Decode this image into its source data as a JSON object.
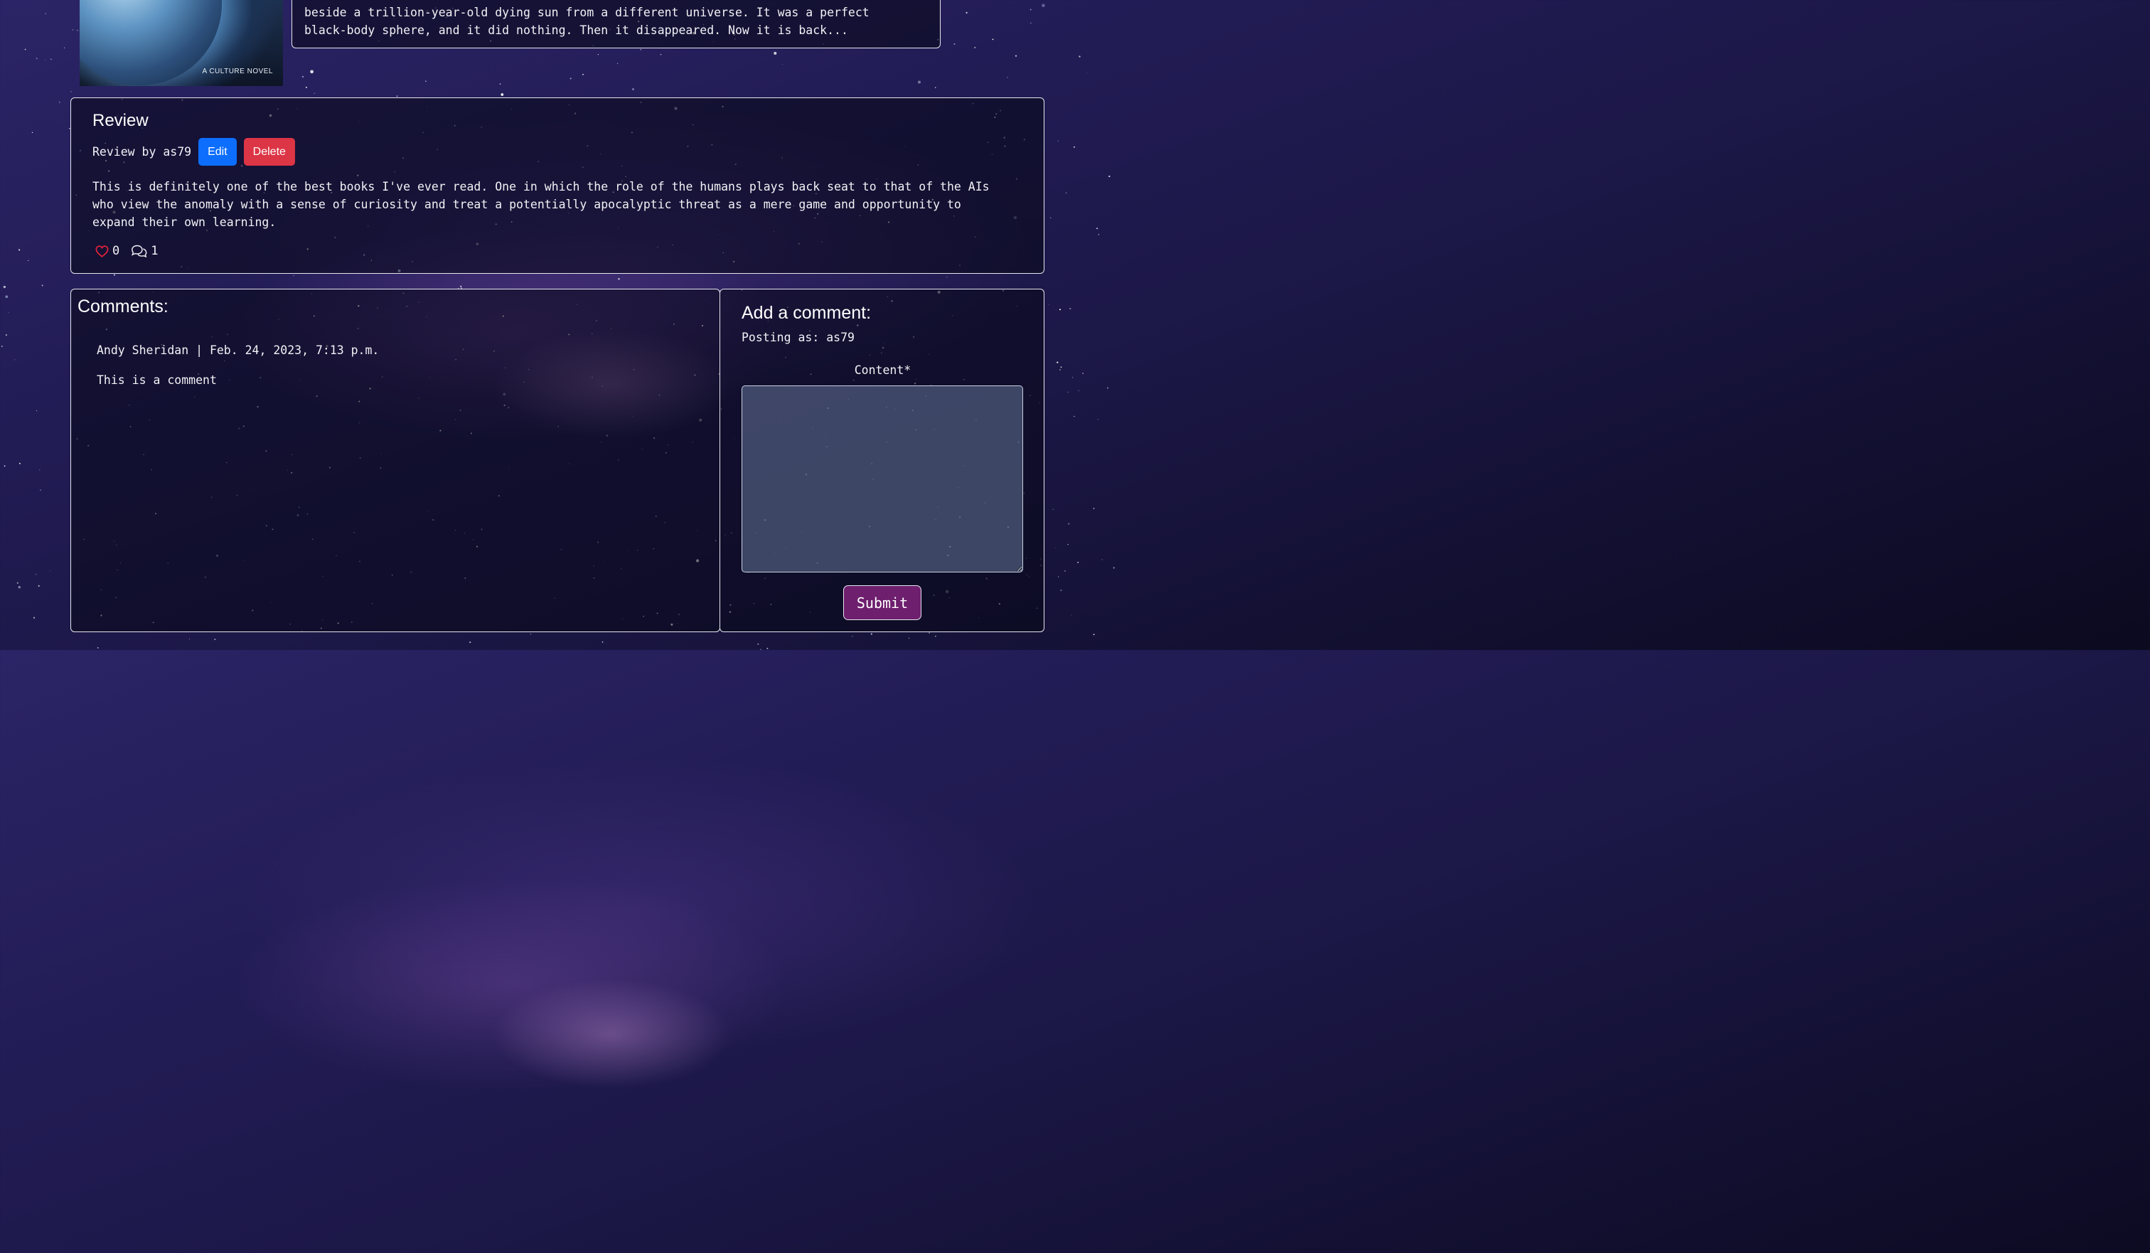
{
  "book": {
    "cover_caption": "A CULTURE NOVEL",
    "synopsis_lines": [
      "beside a trillion-year-old dying sun from a different universe. It was a perfect",
      "black-body sphere, and it did nothing. Then it disappeared. Now it is back..."
    ]
  },
  "review": {
    "title": "Review",
    "by_label": "Review by as79",
    "edit_label": "Edit",
    "delete_label": "Delete",
    "body_lines": [
      "This is definitely one of the best books I've ever read. One in which the role of the humans plays back seat to that of the AIs",
      "who view the anomaly with a sense of curiosity and treat a potentially apocalyptic threat as a mere game and opportunity to",
      "expand their own learning."
    ],
    "likes": "0",
    "comment_count": "1",
    "heart_icon": "heart-outline-icon",
    "comment_icon": "chat-bubbles-icon"
  },
  "comments": {
    "title": "Comments:",
    "items": [
      {
        "meta": "Andy Sheridan | Feb. 24, 2023, 7:13 p.m.",
        "body": "This is a comment"
      }
    ]
  },
  "add_comment": {
    "title": "Add a comment:",
    "posting_as": "Posting as: as79",
    "content_label": "Content*",
    "content_value": "",
    "submit_label": "Submit"
  },
  "colors": {
    "edit": "#0d6efd",
    "delete": "#dc3545",
    "submit": "#6e1f6e",
    "heart": "#e0223c"
  }
}
